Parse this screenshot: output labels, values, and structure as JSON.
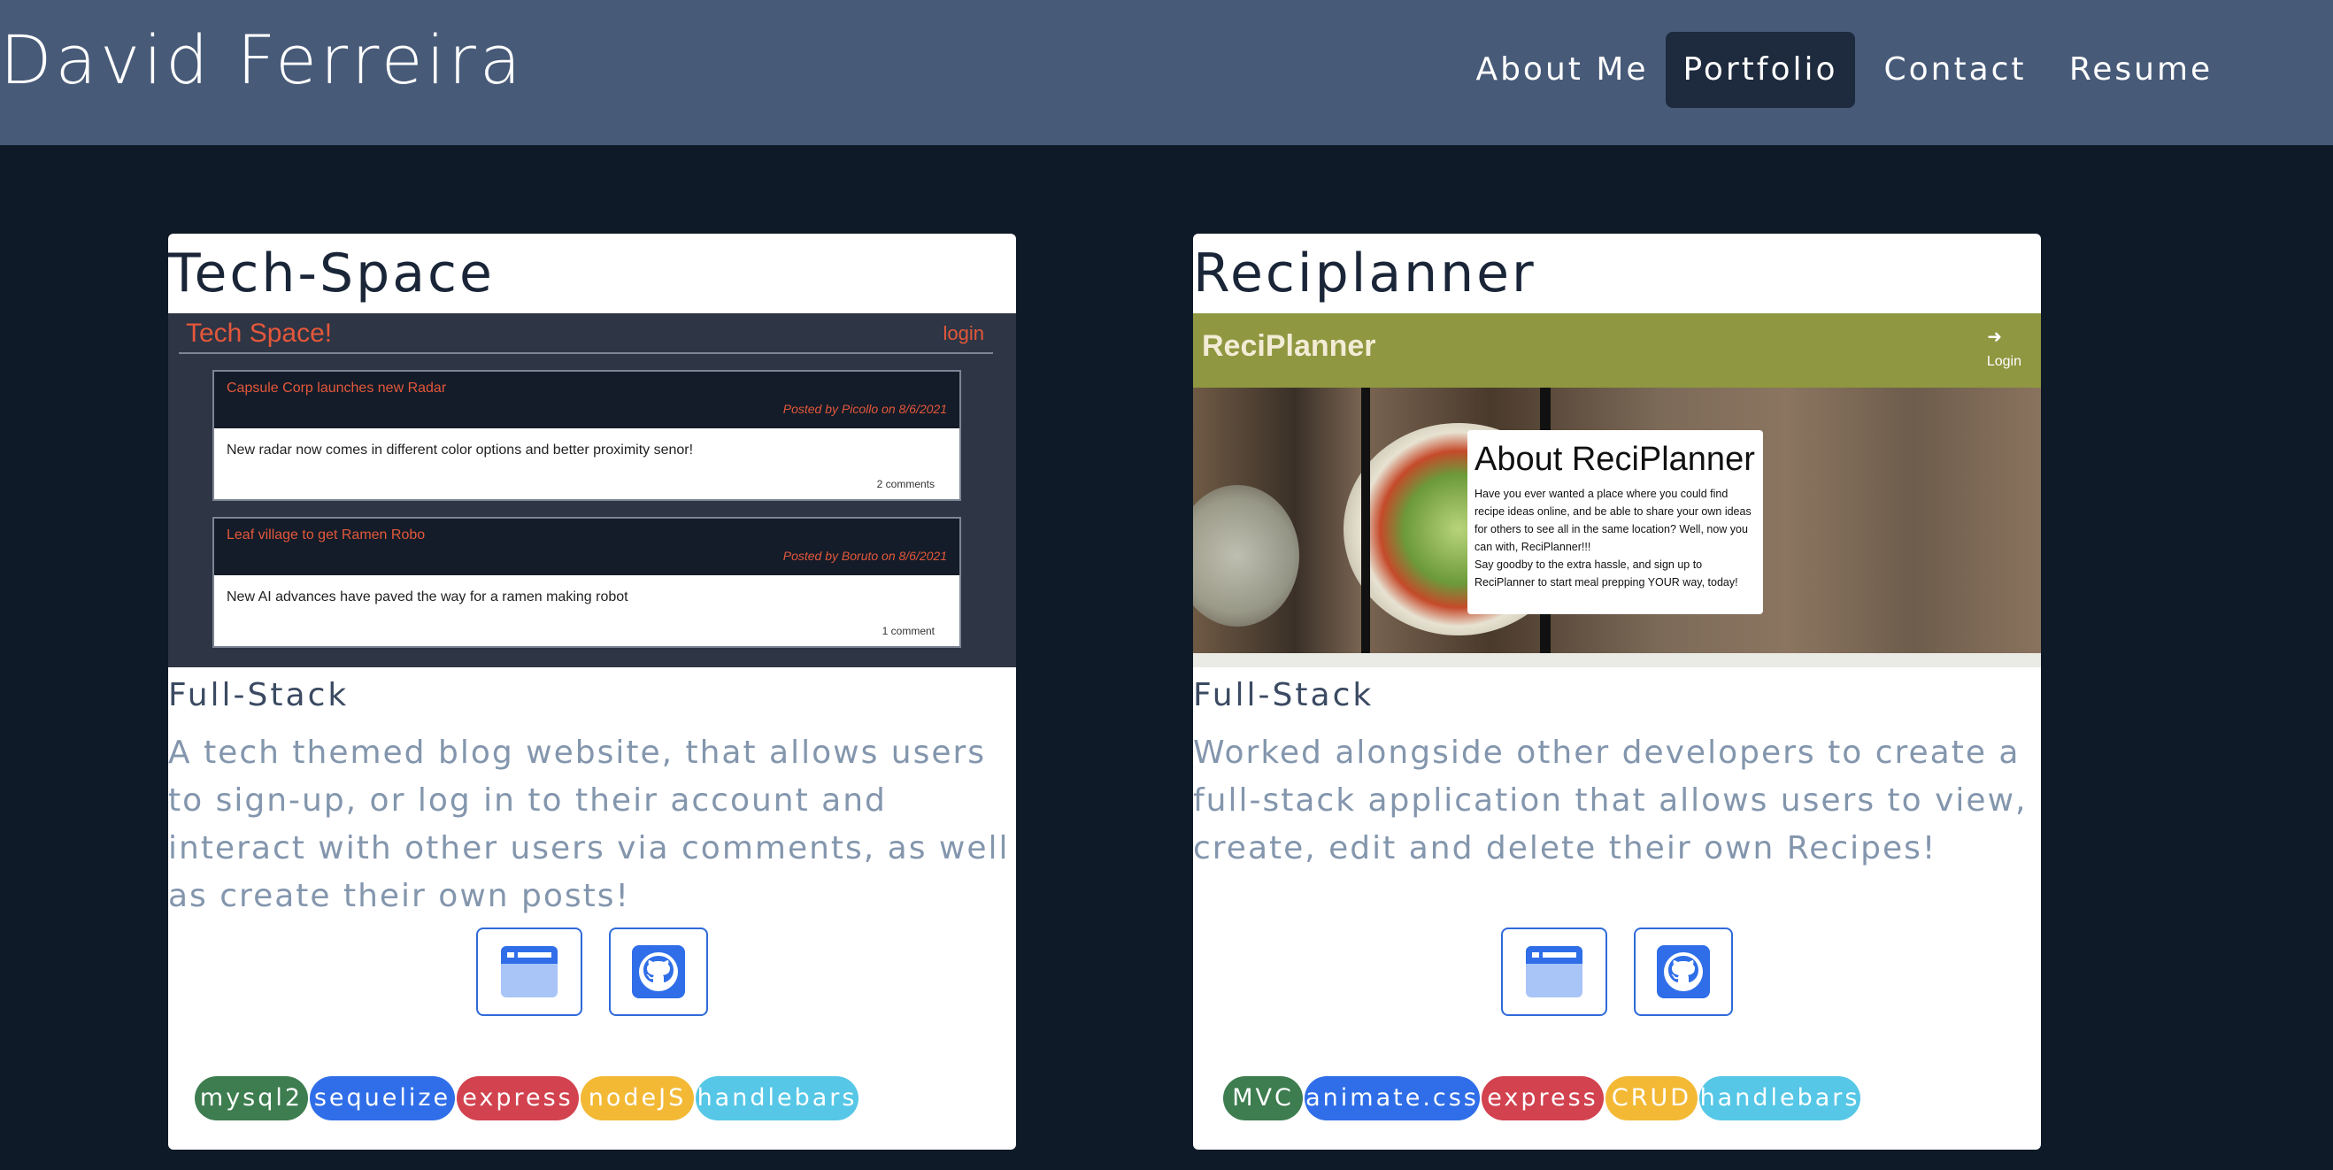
{
  "header": {
    "brand": "David Ferreira",
    "nav": [
      {
        "label": "About Me",
        "active": false
      },
      {
        "label": "Portfolio",
        "active": true
      },
      {
        "label": "Contact",
        "active": false
      },
      {
        "label": "Resume",
        "active": false
      }
    ]
  },
  "colors": {
    "header_bg": "#475a78",
    "page_bg": "#0f1a28",
    "active_nav_bg": "#1e2a3d",
    "button_border": "#2f6ad8"
  },
  "projects": [
    {
      "title": "Tech-Space",
      "subtitle": "Full-Stack",
      "description": "A tech themed blog website, that allows users to sign-up, or log in to their account and interact with other users via comments, as well as create their own posts!",
      "buttons": [
        {
          "icon": "browser-window-icon"
        },
        {
          "icon": "github-icon"
        }
      ],
      "tags": [
        {
          "label": "mysql2",
          "color": "#3d7d4f"
        },
        {
          "label": "sequelize",
          "color": "#2f6ee8"
        },
        {
          "label": "express",
          "color": "#d2424f"
        },
        {
          "label": "nodeJS",
          "color": "#f3b935"
        },
        {
          "label": "handlebars",
          "color": "#56c7e6"
        }
      ],
      "preview": {
        "title": "Tech Space!",
        "login": "login",
        "posts": [
          {
            "title": "Capsule Corp launches new Radar",
            "meta": "Posted by Picollo on 8/6/2021",
            "body": "New radar now comes in different color options and better proximity senor!",
            "comments": "2 comments"
          },
          {
            "title": "Leaf village to get Ramen Robo",
            "meta": "Posted by Boruto on 8/6/2021",
            "body": "New AI advances have paved the way for a ramen making robot",
            "comments": "1 comment"
          }
        ]
      }
    },
    {
      "title": "Reciplanner",
      "subtitle": "Full-Stack",
      "description": "Worked alongside other developers to create a full-stack application that allows users to view, create, edit and delete their own Recipes!",
      "buttons": [
        {
          "icon": "browser-window-icon"
        },
        {
          "icon": "github-icon"
        }
      ],
      "tags": [
        {
          "label": "MVC",
          "color": "#3d7d4f"
        },
        {
          "label": "animate.css",
          "color": "#2f6ee8"
        },
        {
          "label": "express",
          "color": "#d2424f"
        },
        {
          "label": "CRUD",
          "color": "#f3b935"
        },
        {
          "label": "handlebars",
          "color": "#56c7e6"
        }
      ],
      "preview": {
        "logo": "ReciPlanner",
        "login": "Login",
        "box_title": "About ReciPlanner",
        "box_text_1": "Have you ever wanted a place where you could find recipe ideas online, and be able to share your own ideas for others to see all in the same location? Well, now you can with, ReciPlanner!!!",
        "box_text_2": "Say goodby to the extra hassle, and sign up to ReciPlanner to start meal prepping YOUR way, today!"
      }
    }
  ]
}
